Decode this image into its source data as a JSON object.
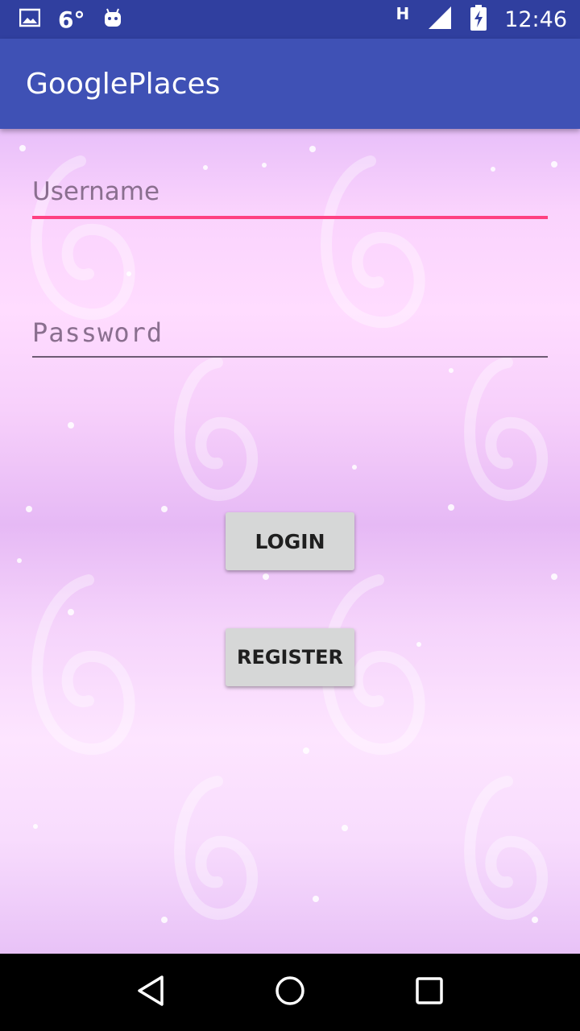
{
  "status_bar": {
    "temperature": "6°",
    "network_type": "H",
    "time": "12:46",
    "icons": [
      "image-icon",
      "android-icon",
      "signal-icon",
      "battery-charging-icon"
    ]
  },
  "app_bar": {
    "title": "GooglePlaces"
  },
  "form": {
    "username_placeholder": "Username",
    "password_placeholder": "Password",
    "login_label": "LOGIN",
    "register_label": "REGISTER"
  },
  "nav_bar": {
    "icons": [
      "back-icon",
      "home-icon",
      "recents-icon"
    ]
  },
  "colors": {
    "status_bar": "#303f9f",
    "app_bar": "#3f51b5",
    "accent": "#ff4081",
    "button": "#d6d7d7"
  }
}
